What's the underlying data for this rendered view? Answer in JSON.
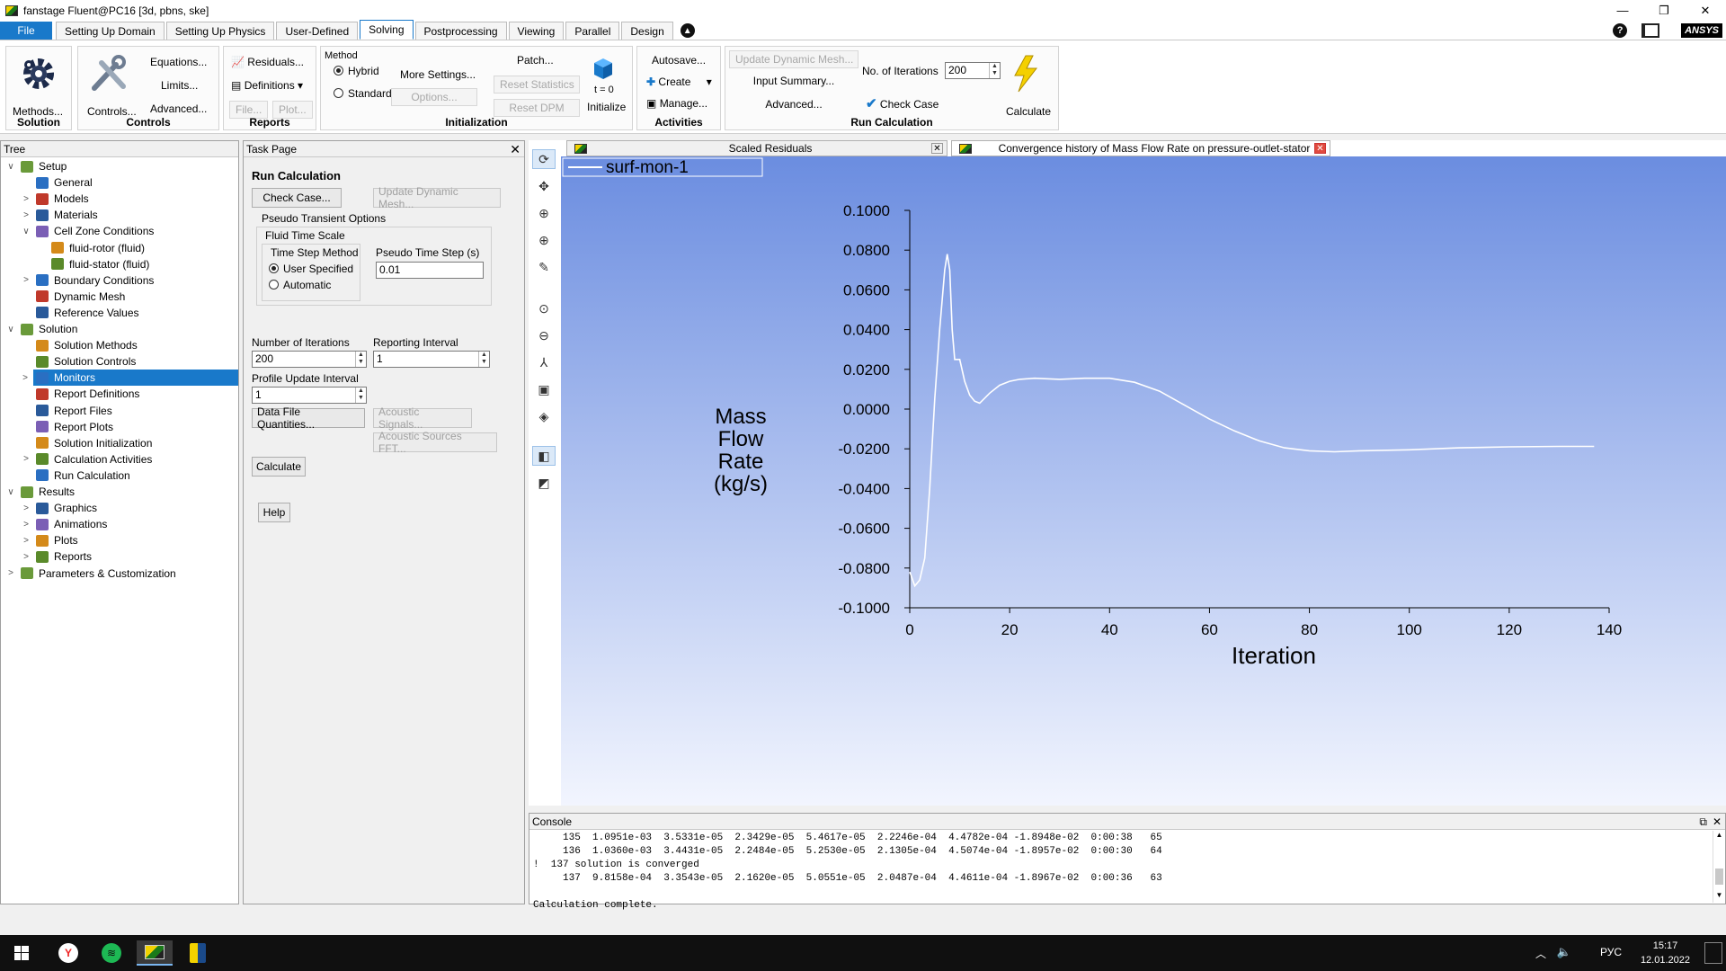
{
  "window": {
    "title": "fanstage Fluent@PC16  [3d, pbns, ske]"
  },
  "menu": {
    "file": "File",
    "tabs": [
      "Setting Up Domain",
      "Setting Up Physics",
      "User-Defined",
      "Solving",
      "Postprocessing",
      "Viewing",
      "Parallel",
      "Design"
    ],
    "active_tab": "Solving",
    "brand": "ANSYS"
  },
  "ribbon": {
    "solution": {
      "label": "Solution",
      "methods": "Methods..."
    },
    "controls": {
      "label": "Controls",
      "controls": "Controls...",
      "equations": "Equations...",
      "limits": "Limits...",
      "advanced": "Advanced..."
    },
    "reports": {
      "label": "Reports",
      "residuals": "Residuals...",
      "definitions": "Definitions",
      "file": "File...",
      "plot": "Plot..."
    },
    "initialization": {
      "label": "Initialization",
      "method": "Method",
      "hybrid": "Hybrid",
      "standard": "Standard",
      "more_settings": "More Settings...",
      "options": "Options...",
      "patch": "Patch...",
      "reset_statistics": "Reset Statistics",
      "reset_dpm": "Reset DPM",
      "t0": "t = 0",
      "initialize": "Initialize"
    },
    "activities": {
      "label": "Activities",
      "autosave": "Autosave...",
      "create": "Create",
      "manage": "Manage..."
    },
    "run": {
      "label": "Run Calculation",
      "update_mesh": "Update Dynamic Mesh...",
      "input_summary": "Input Summary...",
      "advanced": "Advanced...",
      "iterations_label": "No. of Iterations",
      "iterations_value": "200",
      "check_case": "Check Case",
      "calculate": "Calculate"
    }
  },
  "tree": {
    "header": "Tree",
    "items": [
      {
        "label": "Setup",
        "level": 0,
        "exp": "∨"
      },
      {
        "label": "General",
        "level": 1,
        "exp": ""
      },
      {
        "label": "Models",
        "level": 1,
        "exp": ">"
      },
      {
        "label": "Materials",
        "level": 1,
        "exp": ">"
      },
      {
        "label": "Cell Zone Conditions",
        "level": 1,
        "exp": "∨"
      },
      {
        "label": "fluid-rotor (fluid)",
        "level": 2,
        "exp": ""
      },
      {
        "label": "fluid-stator (fluid)",
        "level": 2,
        "exp": ""
      },
      {
        "label": "Boundary Conditions",
        "level": 1,
        "exp": ">"
      },
      {
        "label": "Dynamic Mesh",
        "level": 1,
        "exp": ""
      },
      {
        "label": "Reference Values",
        "level": 1,
        "exp": ""
      },
      {
        "label": "Solution",
        "level": 0,
        "exp": "∨"
      },
      {
        "label": "Solution Methods",
        "level": 1,
        "exp": ""
      },
      {
        "label": "Solution Controls",
        "level": 1,
        "exp": ""
      },
      {
        "label": "Monitors",
        "level": 1,
        "exp": ">",
        "selected": true
      },
      {
        "label": "Report Definitions",
        "level": 1,
        "exp": ""
      },
      {
        "label": "Report Files",
        "level": 1,
        "exp": ""
      },
      {
        "label": "Report Plots",
        "level": 1,
        "exp": ""
      },
      {
        "label": "Solution Initialization",
        "level": 1,
        "exp": ""
      },
      {
        "label": "Calculation Activities",
        "level": 1,
        "exp": ">"
      },
      {
        "label": "Run Calculation",
        "level": 1,
        "exp": ""
      },
      {
        "label": "Results",
        "level": 0,
        "exp": "∨"
      },
      {
        "label": "Graphics",
        "level": 1,
        "exp": ">"
      },
      {
        "label": "Animations",
        "level": 1,
        "exp": ">"
      },
      {
        "label": "Plots",
        "level": 1,
        "exp": ">"
      },
      {
        "label": "Reports",
        "level": 1,
        "exp": ">"
      },
      {
        "label": "Parameters & Customization",
        "level": 0,
        "exp": ">"
      }
    ]
  },
  "task": {
    "header": "Task Page",
    "title": "Run Calculation",
    "check_case": "Check Case...",
    "update_mesh": "Update Dynamic Mesh...",
    "pseudo_options": "Pseudo Transient Options",
    "fluid_time_scale": "Fluid Time Scale",
    "time_step_method": "Time Step Method",
    "user_specified": "User Specified",
    "automatic": "Automatic",
    "pseudo_time_step_label": "Pseudo Time Step (s)",
    "pseudo_time_step_value": "0.01",
    "num_iterations_label": "Number of Iterations",
    "num_iterations_value": "200",
    "reporting_interval_label": "Reporting Interval",
    "reporting_interval_value": "1",
    "profile_update_label": "Profile Update Interval",
    "profile_update_value": "1",
    "data_file": "Data File Quantities...",
    "acoustic_signals": "Acoustic Signals...",
    "acoustic_sources": "Acoustic Sources FFT...",
    "calculate": "Calculate",
    "help": "Help"
  },
  "graphics": {
    "tab1": "Scaled Residuals",
    "tab2": "Convergence history of Mass Flow Rate on pressure-outlet-stator"
  },
  "chart_data": {
    "type": "line",
    "series": [
      {
        "name": "surf-mon-1",
        "color": "#ffffff",
        "x": [
          0,
          1,
          2,
          3,
          4,
          5,
          6,
          7,
          7.5,
          8,
          8.5,
          9,
          10,
          11,
          12,
          13,
          14,
          16,
          18,
          20,
          22,
          25,
          30,
          35,
          40,
          45,
          50,
          55,
          60,
          65,
          70,
          75,
          80,
          85,
          90,
          100,
          110,
          120,
          130,
          137
        ],
        "y": [
          -0.082,
          -0.089,
          -0.086,
          -0.075,
          -0.04,
          0.005,
          0.04,
          0.07,
          0.078,
          0.07,
          0.04,
          0.025,
          0.025,
          0.014,
          0.007,
          0.004,
          0.003,
          0.008,
          0.012,
          0.014,
          0.015,
          0.0155,
          0.015,
          0.0155,
          0.0155,
          0.0135,
          0.009,
          0.002,
          -0.005,
          -0.011,
          -0.016,
          -0.0195,
          -0.021,
          -0.0215,
          -0.021,
          -0.0205,
          -0.0195,
          -0.019,
          -0.0188,
          -0.0188
        ]
      }
    ],
    "xlabel": "Iteration",
    "ylabel": [
      "Mass",
      "Flow",
      "Rate",
      "(kg/s)"
    ],
    "xlim": [
      0,
      140
    ],
    "ylim": [
      -0.1,
      0.1
    ],
    "xticks": [
      "0",
      "20",
      "40",
      "60",
      "80",
      "100",
      "120",
      "140"
    ],
    "yticks": [
      "0.1000",
      "0.0800",
      "0.0600",
      "0.0400",
      "0.0200",
      "0.0000",
      "-0.0200",
      "-0.0400",
      "-0.0600",
      "-0.0800",
      "-0.1000"
    ],
    "grid": false,
    "legend": "top-left"
  },
  "console": {
    "header": "Console",
    "lines": [
      "     135  1.0951e-03  3.5331e-05  2.3429e-05  5.4617e-05  2.2246e-04  4.4782e-04 -1.8948e-02  0:00:38   65",
      "     136  1.0360e-03  3.4431e-05  2.2484e-05  5.2530e-05  2.1305e-04  4.5074e-04 -1.8957e-02  0:00:30   64",
      "!  137 solution is converged",
      "     137  9.8158e-04  3.3543e-05  2.1620e-05  5.0551e-05  2.0487e-04  4.4611e-04 -1.8967e-02  0:00:36   63",
      "",
      "Calculation complete."
    ]
  },
  "taskbar": {
    "lang": "РУС",
    "time": "15:17",
    "date": "12.01.2022"
  }
}
